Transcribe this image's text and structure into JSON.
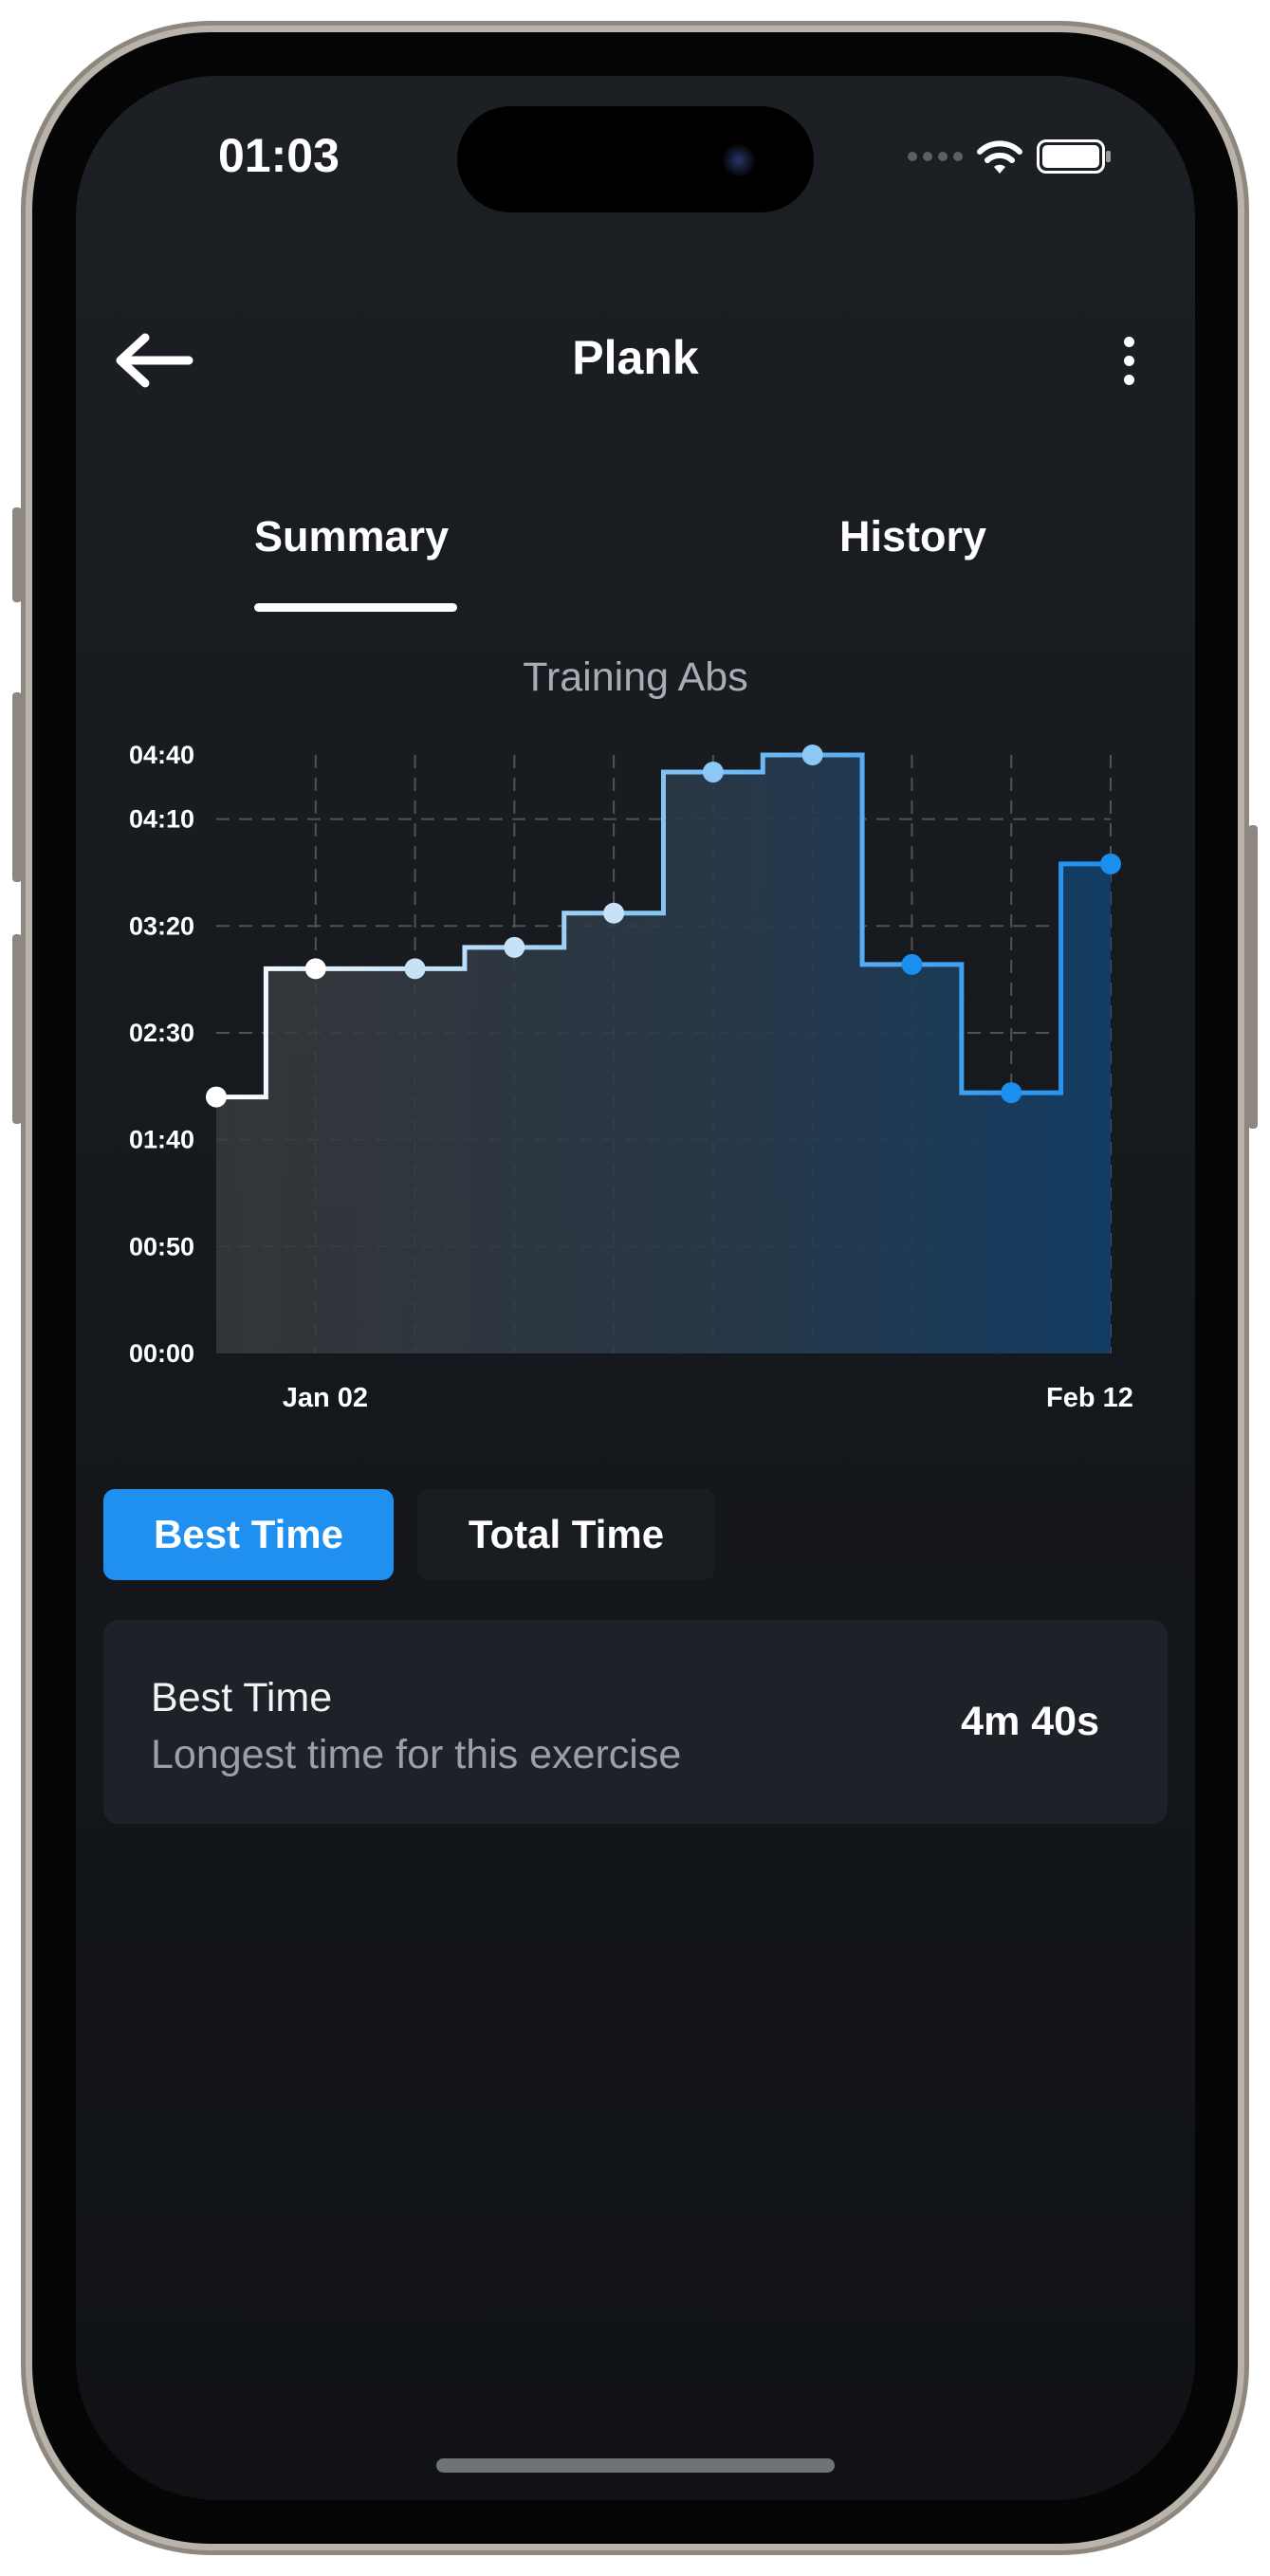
{
  "status_bar": {
    "time": "01:03"
  },
  "nav": {
    "title": "Plank"
  },
  "tabs": [
    {
      "label": "Summary",
      "active": true
    },
    {
      "label": "History",
      "active": false
    }
  ],
  "chart_title": "Training Abs",
  "chart_data": {
    "type": "line",
    "step": true,
    "title": "Training Abs",
    "y_tick_labels": [
      "00:00",
      "00:50",
      "01:40",
      "02:30",
      "03:20",
      "04:10",
      "04:40"
    ],
    "y_ticks_seconds": [
      0,
      50,
      100,
      150,
      200,
      250,
      280
    ],
    "ylim_seconds": [
      0,
      280
    ],
    "x_tick_labels": [
      "Jan 02",
      "Feb 12"
    ],
    "series": [
      {
        "values_seconds": [
          120,
          180,
          180,
          190,
          206,
          272,
          280,
          182,
          122,
          229
        ]
      }
    ],
    "grid": true
  },
  "metric_tabs": [
    {
      "label": "Best Time",
      "active": true
    },
    {
      "label": "Total Time",
      "active": false
    }
  ],
  "info_card": {
    "title": "Best Time",
    "subtitle": "Longest time for this exercise",
    "value": "4m 40s"
  },
  "colors": {
    "accent": "#1f8ff0",
    "background": "#15181c",
    "card": "#1e2228"
  }
}
